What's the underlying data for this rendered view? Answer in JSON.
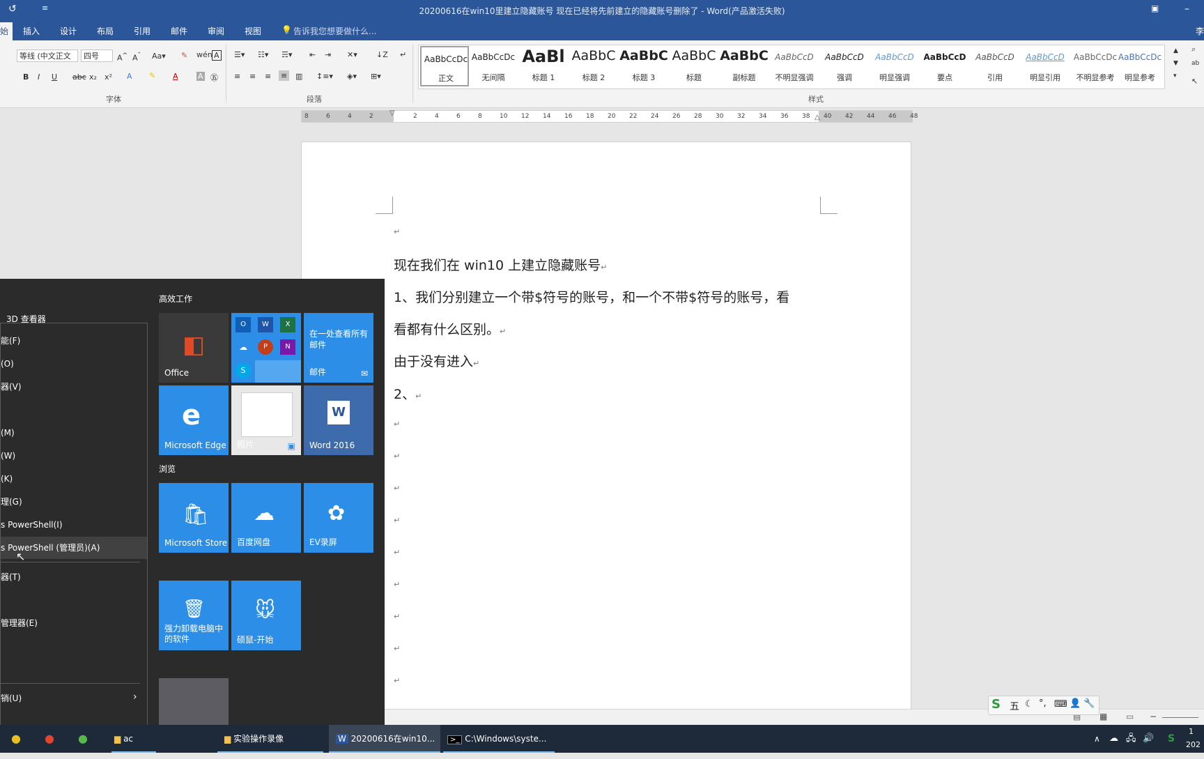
{
  "titlebar": {
    "title": "20200616在win10里建立隐藏账号 现在已经将先前建立的隐藏账号删除了 - Word(产品激活失败)"
  },
  "tabs": {
    "items": [
      "插入",
      "设计",
      "布局",
      "引用",
      "邮件",
      "审阅",
      "视图"
    ],
    "tell_me": "告诉我您想要做什么...",
    "user": "李"
  },
  "ribbon": {
    "font_name": "等线 (中文正文",
    "font_size": "四号",
    "group_font": "字体",
    "group_paragraph": "段落",
    "group_styles": "样式",
    "styles": [
      {
        "sample": "AaBbCcDc",
        "name": "正文"
      },
      {
        "sample": "AaBbCcDc",
        "name": "无间隔"
      },
      {
        "sample": "AaBl",
        "name": "标题 1"
      },
      {
        "sample": "AaBbC",
        "name": "标题 2"
      },
      {
        "sample": "AaBbC",
        "name": "标题 3"
      },
      {
        "sample": "AaBbC",
        "name": "标题"
      },
      {
        "sample": "AaBbC",
        "name": "副标题"
      },
      {
        "sample": "AaBbCcD",
        "name": "不明显强调"
      },
      {
        "sample": "AaBbCcD",
        "name": "强调"
      },
      {
        "sample": "AaBbCcD",
        "name": "明显强调"
      },
      {
        "sample": "AaBbCcD",
        "name": "要点"
      },
      {
        "sample": "AaBbCcD",
        "name": "引用"
      },
      {
        "sample": "AaBbCcD",
        "name": "明显引用"
      },
      {
        "sample": "AaBbCcDc",
        "name": "不明显参考"
      },
      {
        "sample": "AaBbCcDc",
        "name": "明显参考"
      }
    ]
  },
  "ruler": {
    "numbers": [
      "8",
      "6",
      "4",
      "2",
      "2",
      "4",
      "6",
      "8",
      "10",
      "12",
      "14",
      "16",
      "18",
      "20",
      "22",
      "24",
      "26",
      "28",
      "30",
      "32",
      "34",
      "36",
      "38",
      "40",
      "42",
      "44",
      "46",
      "48"
    ]
  },
  "document": {
    "lines": [
      "现在我们在 win10 上建立隐藏账号",
      "1、我们分别建立一个带$符号的账号，和一个不带$符号的账号，看",
      "看都有什么区别。",
      "由于没有进入",
      "2、"
    ],
    "paragraph_mark": "↵"
  },
  "context_menu": {
    "items": [
      "3D 查看器",
      "能(F)",
      "(O)",
      "器(V)",
      "(M)",
      "(W)",
      "(K)",
      "理(G)",
      "s PowerShell(I)",
      "s PowerShell (管理员)(A)",
      "器(T)",
      "管理器(E)",
      "销(U)"
    ]
  },
  "start": {
    "section_1": "高效工作",
    "section_2": "浏览",
    "tiles": {
      "office": "Office",
      "mail_title": "在一处查看所有邮件",
      "mail": "邮件",
      "edge": "Microsoft Edge",
      "photos": "照片",
      "word": "Word 2016",
      "store": "Microsoft Store",
      "baidu": "百度网盘",
      "ev": "EV录屏",
      "uninstall": "强力卸载电脑中的软件",
      "mouse": "硕鼠-开始"
    }
  },
  "taskbar": {
    "items": [
      "ac",
      "实验操作录像",
      "20200616在win10...",
      "C:\\Windows\\syste..."
    ],
    "clock_top": "1",
    "clock_bottom": "202"
  },
  "ime": {
    "label": "五"
  },
  "colors": {
    "word_blue": "#2b579a",
    "tile_blue": "#2d8ee8",
    "start_bg": "#2b2b2b"
  }
}
